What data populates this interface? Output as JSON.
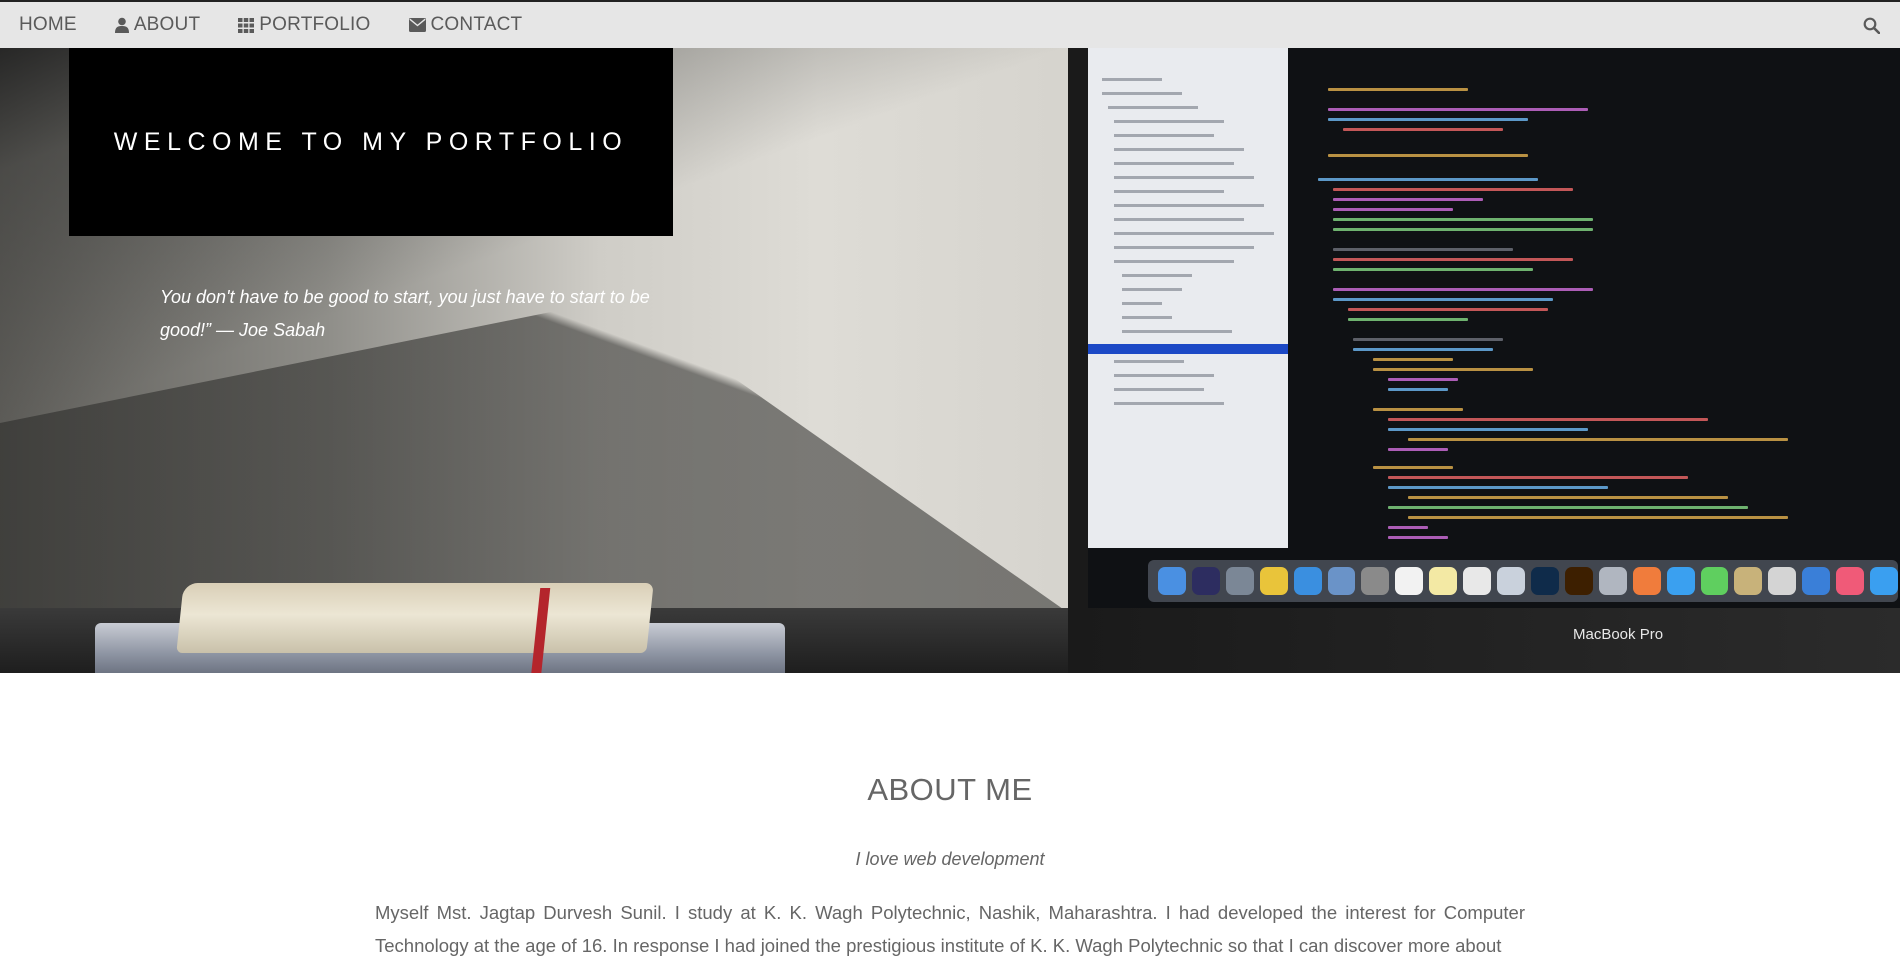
{
  "nav": {
    "items": [
      {
        "label": "HOME",
        "icon": null
      },
      {
        "label": "ABOUT",
        "icon": "user-icon"
      },
      {
        "label": "PORTFOLIO",
        "icon": "grid-icon"
      },
      {
        "label": "CONTACT",
        "icon": "envelope-icon"
      }
    ],
    "search_icon": "search-icon"
  },
  "hero": {
    "welcome_title": "WELCOME TO MY PORTFOLIO",
    "quote": "You don't have to be good to start, you just have to start to be good!” — Joe Sabah",
    "laptop_label": "MacBook Pro"
  },
  "about": {
    "title": "ABOUT ME",
    "subtitle": "I love web development",
    "body": "Myself Mst. Jagtap Durvesh Sunil. I study at K. K. Wagh Polytechnic, Nashik, Maharashtra. I had developed the interest for Computer Technology at the age of 16. In response I had joined the prestigious institute of K. K. Wagh Polytechnic so that I can discover more about"
  },
  "colors": {
    "navbar_bg": "#e6e6e6",
    "nav_text": "#5a5a5a",
    "welcome_bg": "#000000",
    "body_text": "#666666"
  }
}
